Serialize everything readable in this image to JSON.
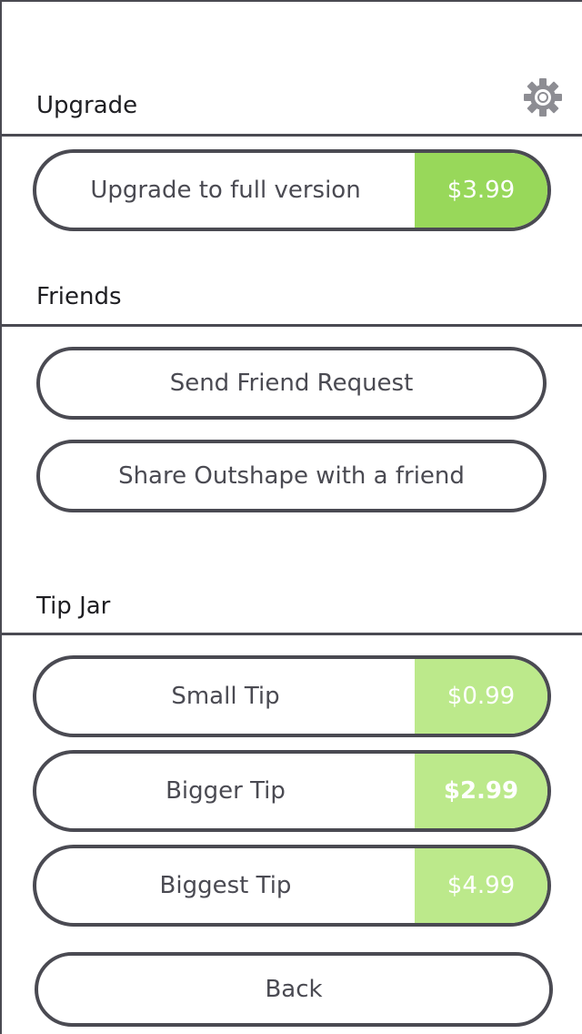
{
  "sections": {
    "upgrade_title": "Upgrade",
    "friends_title": "Friends",
    "tipjar_title": "Tip Jar"
  },
  "upgrade": {
    "label": "Upgrade to full version",
    "price": "$3.99"
  },
  "friends": {
    "send_request": "Send Friend Request",
    "share": "Share Outshape with a friend"
  },
  "tips": [
    {
      "label": "Small Tip",
      "price": "$0.99"
    },
    {
      "label": "Bigger Tip",
      "price": "$2.99"
    },
    {
      "label": "Biggest Tip",
      "price": "$4.99"
    }
  ],
  "back_label": "Back",
  "icons": {
    "settings": "gear-icon"
  },
  "colors": {
    "accent": "#98d85a",
    "accent_light": "#bce98b",
    "outline": "#4a4a52"
  }
}
